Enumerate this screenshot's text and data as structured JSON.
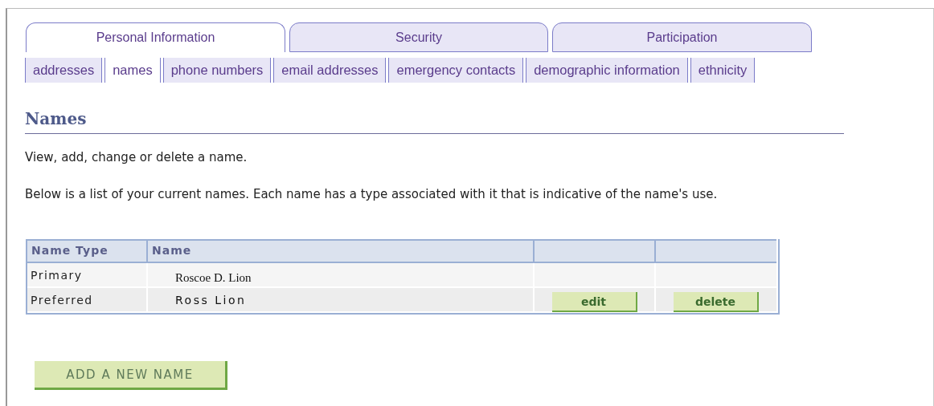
{
  "tabs": [
    {
      "label": "Personal Information",
      "selected": true
    },
    {
      "label": "Security",
      "selected": false
    },
    {
      "label": "Participation",
      "selected": false
    }
  ],
  "subtabs": [
    {
      "label": "addresses",
      "selected": false
    },
    {
      "label": "names",
      "selected": true
    },
    {
      "label": "phone numbers",
      "selected": false
    },
    {
      "label": "email addresses",
      "selected": false
    },
    {
      "label": "emergency contacts",
      "selected": false
    },
    {
      "label": "demographic information",
      "selected": false
    },
    {
      "label": "ethnicity",
      "selected": false
    }
  ],
  "heading": "Names",
  "intro": "View, add, change or delete a name.",
  "description": "Below is a list of your current names. Each name has a type associated with it that is indicative of the name's use.",
  "table": {
    "columns": [
      "Name Type",
      "Name"
    ],
    "rows": [
      {
        "name_type": "Primary",
        "name": "Roscoe D. Lion",
        "kind": "serif",
        "actions": []
      },
      {
        "name_type": "Preferred",
        "name": "Ross Lion",
        "kind": "plain",
        "actions": [
          "edit",
          "delete"
        ]
      }
    ]
  },
  "add_button": "ADD A NEW NAME"
}
